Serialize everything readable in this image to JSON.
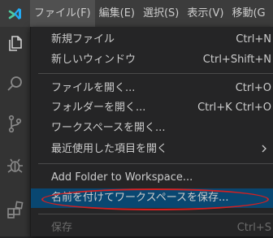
{
  "menubar": {
    "items": [
      {
        "label": "ファイル(F)"
      },
      {
        "label": "編集(E)"
      },
      {
        "label": "選択(S)"
      },
      {
        "label": "表示(V)"
      },
      {
        "label": "移動(G"
      }
    ]
  },
  "activity_icons": [
    "explorer-icon",
    "search-icon",
    "source-control-icon",
    "debug-icon",
    "extensions-icon"
  ],
  "file_menu": {
    "items": [
      {
        "label": "新規ファイル",
        "shortcut": "Ctrl+N"
      },
      {
        "label": "新しいウィンドウ",
        "shortcut": "Ctrl+Shift+N"
      },
      {
        "label": "ファイルを開く...",
        "shortcut": "Ctrl+O"
      },
      {
        "label": "フォルダーを開く...",
        "shortcut": "Ctrl+K Ctrl+O"
      },
      {
        "label": "ワークスペースを開く...",
        "shortcut": ""
      },
      {
        "label": "最近使用した項目を開く",
        "shortcut": ""
      },
      {
        "label": "Add Folder to Workspace...",
        "shortcut": ""
      },
      {
        "label": "名前を付けてワークスペースを保存...",
        "shortcut": ""
      },
      {
        "label": "保存",
        "shortcut": "Ctrl+S"
      }
    ]
  },
  "colors": {
    "accent_selected": "#094771",
    "annotation_red": "#d42020",
    "logo_blue": "#23a9f2",
    "logo_green": "#4ec9a0"
  }
}
